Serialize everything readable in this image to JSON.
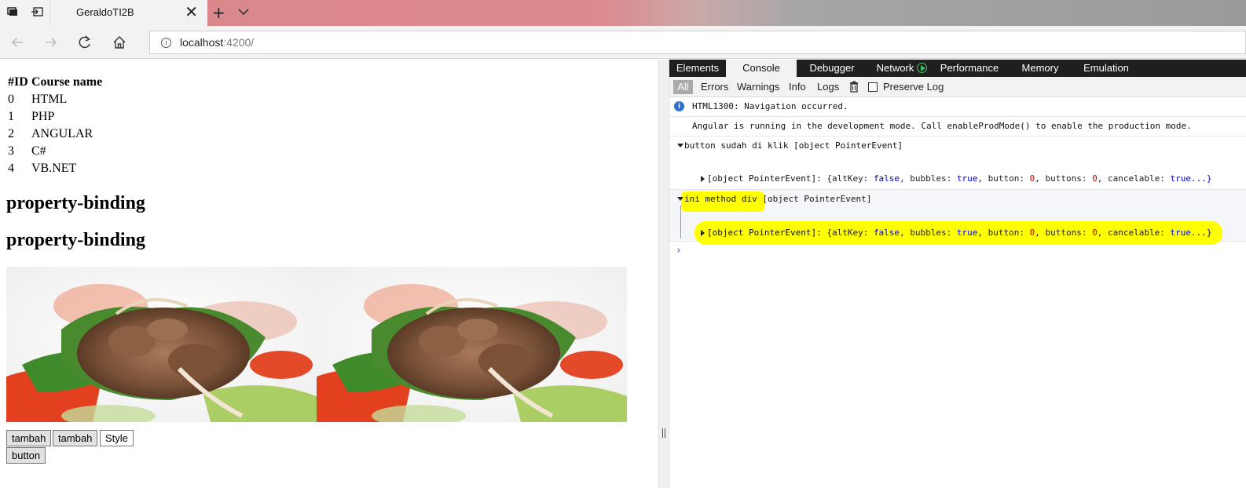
{
  "browser": {
    "tab_title": "GeraldoTI2B",
    "new_tab_symbol": "+",
    "url_host": "localhost",
    "url_port": ":4200/"
  },
  "page": {
    "table": {
      "headers": [
        "#ID",
        "Course name"
      ],
      "rows": [
        {
          "id": "0",
          "name": "HTML"
        },
        {
          "id": "1",
          "name": "PHP"
        },
        {
          "id": "2",
          "name": "ANGULAR"
        },
        {
          "id": "3",
          "name": "C#"
        },
        {
          "id": "4",
          "name": "VB.NET"
        }
      ]
    },
    "headings": [
      "property-binding",
      "property-binding"
    ],
    "buttons": [
      "tambah",
      "tambah",
      "Style",
      "button"
    ]
  },
  "devtools": {
    "tabs": [
      "Elements",
      "Console",
      "Debugger",
      "Network",
      "Performance",
      "Memory",
      "Emulation"
    ],
    "active_tab": "Console",
    "filters": [
      "All",
      "Errors",
      "Warnings",
      "Info",
      "Logs"
    ],
    "preserve_log": "Preserve Log",
    "console": {
      "line1": "HTML1300: Navigation occurred.",
      "line2": "Angular is running in the development mode. Call enableProdMode() to enable the production mode.",
      "line3": "button sudah di klik [object PointerEvent]",
      "line4_label": "[object PointerEvent]: ",
      "line5_hl": "ini method div",
      "line5_rest": " [object PointerEvent]",
      "line6_label": "[object PointerEvent]: ",
      "object_tokens": [
        "{altKey: ",
        "false",
        ", bubbles: ",
        "true",
        ", button: ",
        "0",
        ", buttons: ",
        "0",
        ", cancelable: ",
        "true",
        "...}"
      ]
    },
    "prompt": "›"
  },
  "colors": {
    "highlight": "#ffff00",
    "info_icon": "#2f6fd1",
    "bool": "#0000dd",
    "number": "#d40000"
  }
}
